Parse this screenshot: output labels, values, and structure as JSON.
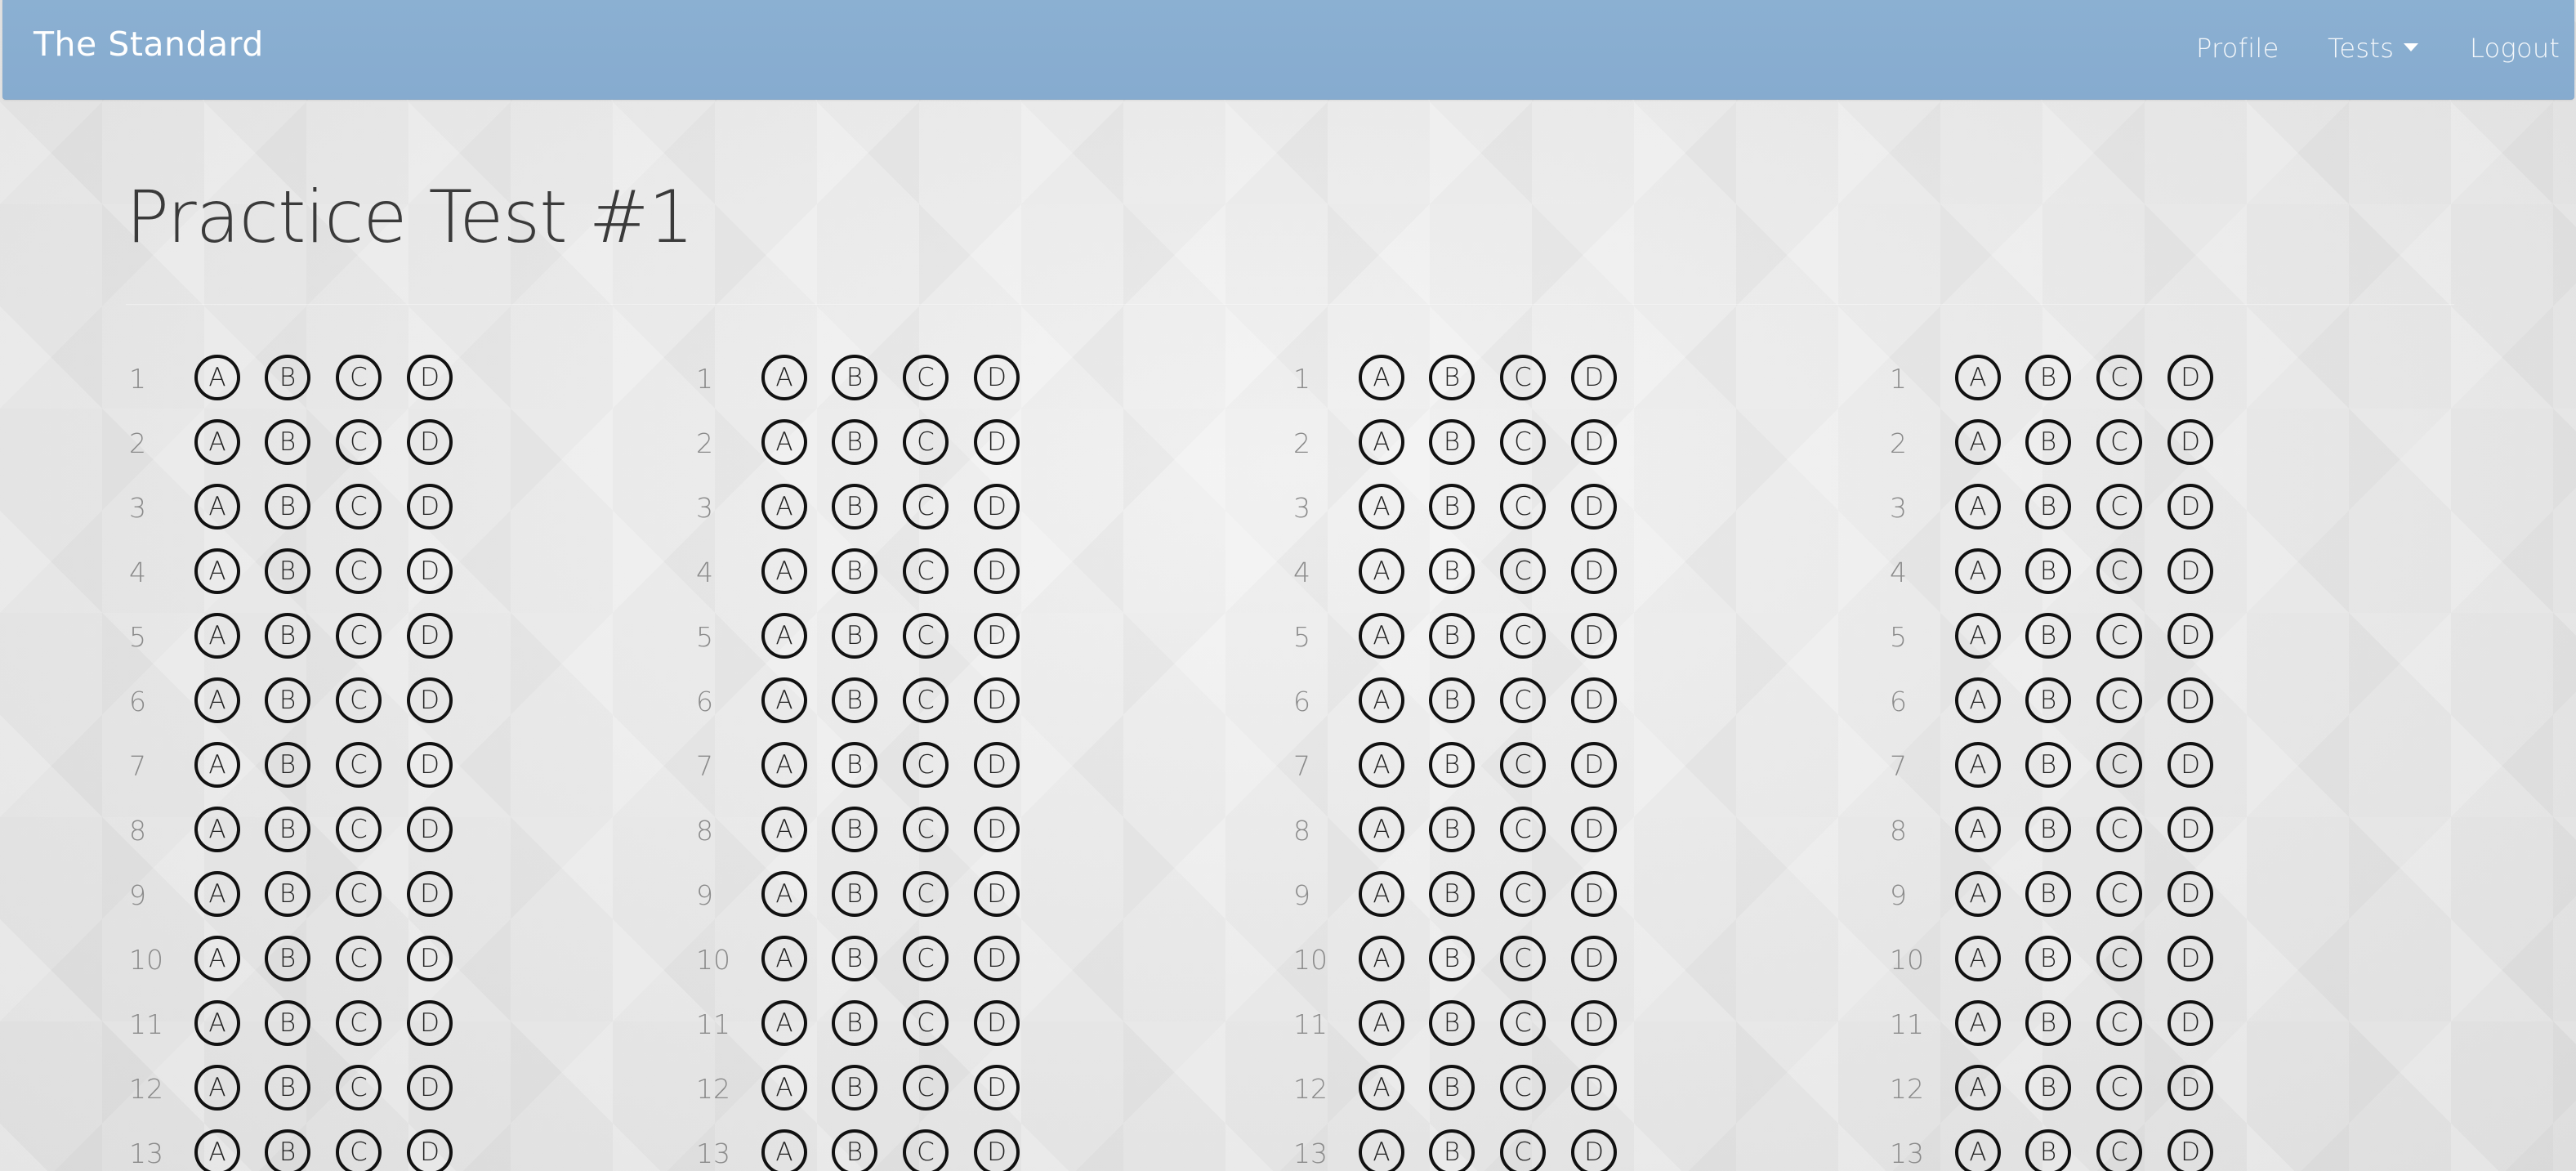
{
  "navbar": {
    "brand": "The Standard",
    "items": [
      {
        "label": "Profile"
      },
      {
        "label": "Tests",
        "has_dropdown": true
      },
      {
        "label": "Logout"
      }
    ]
  },
  "page": {
    "title": "Practice Test #1"
  },
  "answer_sheet": {
    "choices": [
      "A",
      "B",
      "C",
      "D"
    ],
    "columns": [
      {
        "questions": [
          1,
          2,
          3,
          4,
          5,
          6,
          7,
          8,
          9,
          10,
          11,
          12,
          13
        ]
      },
      {
        "questions": [
          1,
          2,
          3,
          4,
          5,
          6,
          7,
          8,
          9,
          10,
          11,
          12,
          13
        ]
      },
      {
        "questions": [
          1,
          2,
          3,
          4,
          5,
          6,
          7,
          8,
          9,
          10,
          11,
          12,
          13
        ]
      },
      {
        "questions": [
          1,
          2,
          3,
          4,
          5,
          6,
          7,
          8,
          9,
          10,
          11,
          12,
          13
        ]
      }
    ]
  },
  "colors": {
    "navbar": "#88aed1",
    "background": "#e8e8e8",
    "bubble_border": "#111111",
    "question_number": "#8a8a8a"
  },
  "icons": {
    "tests_dropdown": "caret-down-icon"
  }
}
